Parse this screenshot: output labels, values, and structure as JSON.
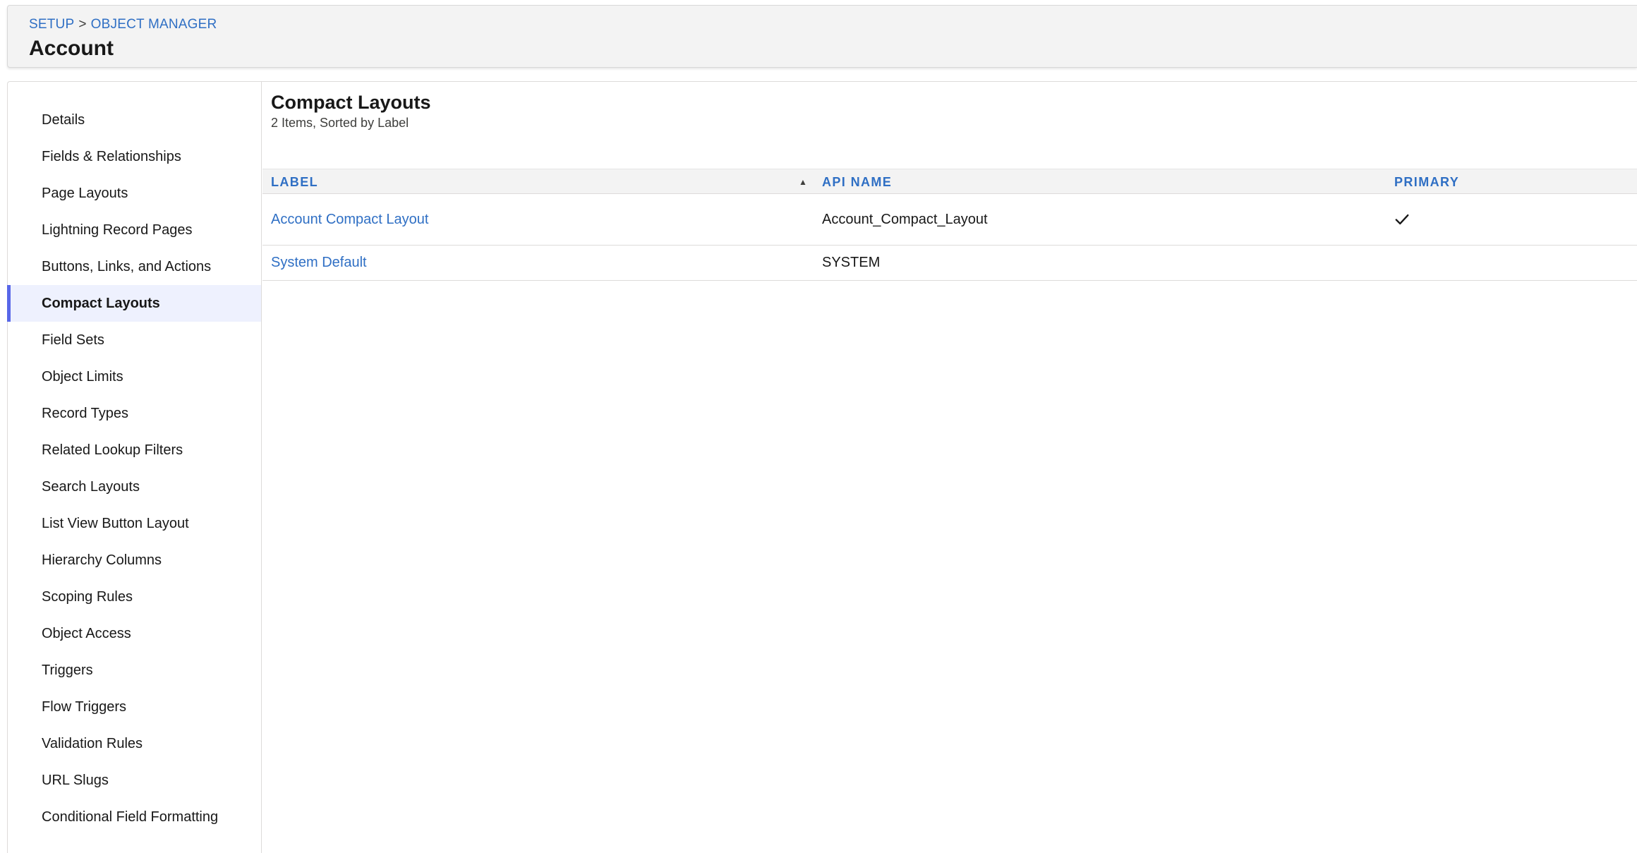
{
  "header": {
    "breadcrumb": {
      "setup": "SETUP",
      "separator": ">",
      "object_manager": "OBJECT MANAGER"
    },
    "title": "Account"
  },
  "sidebar": {
    "items": [
      {
        "label": "Details"
      },
      {
        "label": "Fields & Relationships"
      },
      {
        "label": "Page Layouts"
      },
      {
        "label": "Lightning Record Pages"
      },
      {
        "label": "Buttons, Links, and Actions"
      },
      {
        "label": "Compact Layouts",
        "active": true
      },
      {
        "label": "Field Sets"
      },
      {
        "label": "Object Limits"
      },
      {
        "label": "Record Types"
      },
      {
        "label": "Related Lookup Filters"
      },
      {
        "label": "Search Layouts"
      },
      {
        "label": "List View Button Layout"
      },
      {
        "label": "Hierarchy Columns"
      },
      {
        "label": "Scoping Rules"
      },
      {
        "label": "Object Access"
      },
      {
        "label": "Triggers"
      },
      {
        "label": "Flow Triggers"
      },
      {
        "label": "Validation Rules"
      },
      {
        "label": "URL Slugs"
      },
      {
        "label": "Conditional Field Formatting"
      }
    ]
  },
  "content": {
    "title": "Compact Layouts",
    "subtitle": "2 Items, Sorted by Label",
    "table": {
      "columns": {
        "label": "LABEL",
        "api_name": "API NAME",
        "primary": "PRIMARY"
      },
      "sort_icon": "sort-ascending-icon",
      "rows": [
        {
          "label": "Account Compact Layout",
          "api_name": "Account_Compact_Layout",
          "primary": true
        },
        {
          "label": "System Default",
          "api_name": "SYSTEM",
          "primary": false
        }
      ]
    }
  },
  "colors": {
    "link": "#2f6fc4",
    "active_accent": "#5867e8",
    "active_bg": "#eef1fe",
    "header_bg": "#f3f3f3"
  }
}
